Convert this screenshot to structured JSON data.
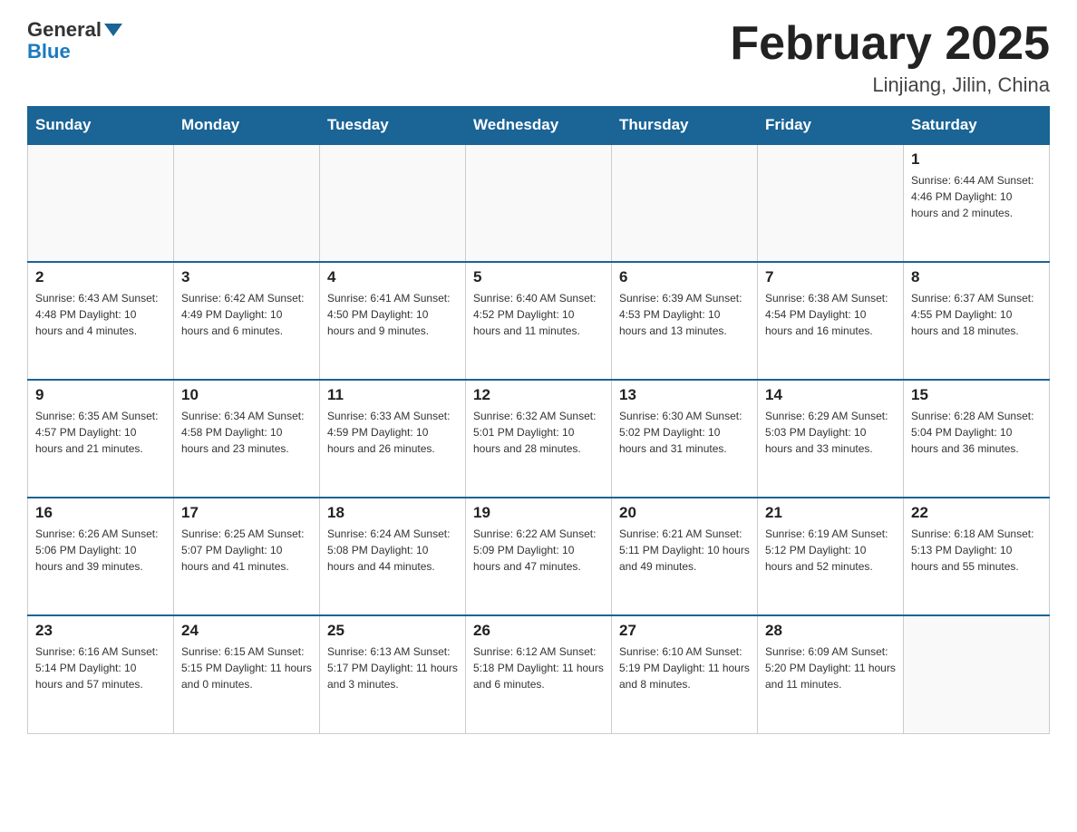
{
  "header": {
    "logo_general": "General",
    "logo_blue": "Blue",
    "title": "February 2025",
    "subtitle": "Linjiang, Jilin, China"
  },
  "days_of_week": [
    "Sunday",
    "Monday",
    "Tuesday",
    "Wednesday",
    "Thursday",
    "Friday",
    "Saturday"
  ],
  "weeks": [
    [
      {
        "day": "",
        "info": ""
      },
      {
        "day": "",
        "info": ""
      },
      {
        "day": "",
        "info": ""
      },
      {
        "day": "",
        "info": ""
      },
      {
        "day": "",
        "info": ""
      },
      {
        "day": "",
        "info": ""
      },
      {
        "day": "1",
        "info": "Sunrise: 6:44 AM\nSunset: 4:46 PM\nDaylight: 10 hours and 2 minutes."
      }
    ],
    [
      {
        "day": "2",
        "info": "Sunrise: 6:43 AM\nSunset: 4:48 PM\nDaylight: 10 hours and 4 minutes."
      },
      {
        "day": "3",
        "info": "Sunrise: 6:42 AM\nSunset: 4:49 PM\nDaylight: 10 hours and 6 minutes."
      },
      {
        "day": "4",
        "info": "Sunrise: 6:41 AM\nSunset: 4:50 PM\nDaylight: 10 hours and 9 minutes."
      },
      {
        "day": "5",
        "info": "Sunrise: 6:40 AM\nSunset: 4:52 PM\nDaylight: 10 hours and 11 minutes."
      },
      {
        "day": "6",
        "info": "Sunrise: 6:39 AM\nSunset: 4:53 PM\nDaylight: 10 hours and 13 minutes."
      },
      {
        "day": "7",
        "info": "Sunrise: 6:38 AM\nSunset: 4:54 PM\nDaylight: 10 hours and 16 minutes."
      },
      {
        "day": "8",
        "info": "Sunrise: 6:37 AM\nSunset: 4:55 PM\nDaylight: 10 hours and 18 minutes."
      }
    ],
    [
      {
        "day": "9",
        "info": "Sunrise: 6:35 AM\nSunset: 4:57 PM\nDaylight: 10 hours and 21 minutes."
      },
      {
        "day": "10",
        "info": "Sunrise: 6:34 AM\nSunset: 4:58 PM\nDaylight: 10 hours and 23 minutes."
      },
      {
        "day": "11",
        "info": "Sunrise: 6:33 AM\nSunset: 4:59 PM\nDaylight: 10 hours and 26 minutes."
      },
      {
        "day": "12",
        "info": "Sunrise: 6:32 AM\nSunset: 5:01 PM\nDaylight: 10 hours and 28 minutes."
      },
      {
        "day": "13",
        "info": "Sunrise: 6:30 AM\nSunset: 5:02 PM\nDaylight: 10 hours and 31 minutes."
      },
      {
        "day": "14",
        "info": "Sunrise: 6:29 AM\nSunset: 5:03 PM\nDaylight: 10 hours and 33 minutes."
      },
      {
        "day": "15",
        "info": "Sunrise: 6:28 AM\nSunset: 5:04 PM\nDaylight: 10 hours and 36 minutes."
      }
    ],
    [
      {
        "day": "16",
        "info": "Sunrise: 6:26 AM\nSunset: 5:06 PM\nDaylight: 10 hours and 39 minutes."
      },
      {
        "day": "17",
        "info": "Sunrise: 6:25 AM\nSunset: 5:07 PM\nDaylight: 10 hours and 41 minutes."
      },
      {
        "day": "18",
        "info": "Sunrise: 6:24 AM\nSunset: 5:08 PM\nDaylight: 10 hours and 44 minutes."
      },
      {
        "day": "19",
        "info": "Sunrise: 6:22 AM\nSunset: 5:09 PM\nDaylight: 10 hours and 47 minutes."
      },
      {
        "day": "20",
        "info": "Sunrise: 6:21 AM\nSunset: 5:11 PM\nDaylight: 10 hours and 49 minutes."
      },
      {
        "day": "21",
        "info": "Sunrise: 6:19 AM\nSunset: 5:12 PM\nDaylight: 10 hours and 52 minutes."
      },
      {
        "day": "22",
        "info": "Sunrise: 6:18 AM\nSunset: 5:13 PM\nDaylight: 10 hours and 55 minutes."
      }
    ],
    [
      {
        "day": "23",
        "info": "Sunrise: 6:16 AM\nSunset: 5:14 PM\nDaylight: 10 hours and 57 minutes."
      },
      {
        "day": "24",
        "info": "Sunrise: 6:15 AM\nSunset: 5:15 PM\nDaylight: 11 hours and 0 minutes."
      },
      {
        "day": "25",
        "info": "Sunrise: 6:13 AM\nSunset: 5:17 PM\nDaylight: 11 hours and 3 minutes."
      },
      {
        "day": "26",
        "info": "Sunrise: 6:12 AM\nSunset: 5:18 PM\nDaylight: 11 hours and 6 minutes."
      },
      {
        "day": "27",
        "info": "Sunrise: 6:10 AM\nSunset: 5:19 PM\nDaylight: 11 hours and 8 minutes."
      },
      {
        "day": "28",
        "info": "Sunrise: 6:09 AM\nSunset: 5:20 PM\nDaylight: 11 hours and 11 minutes."
      },
      {
        "day": "",
        "info": ""
      }
    ]
  ]
}
